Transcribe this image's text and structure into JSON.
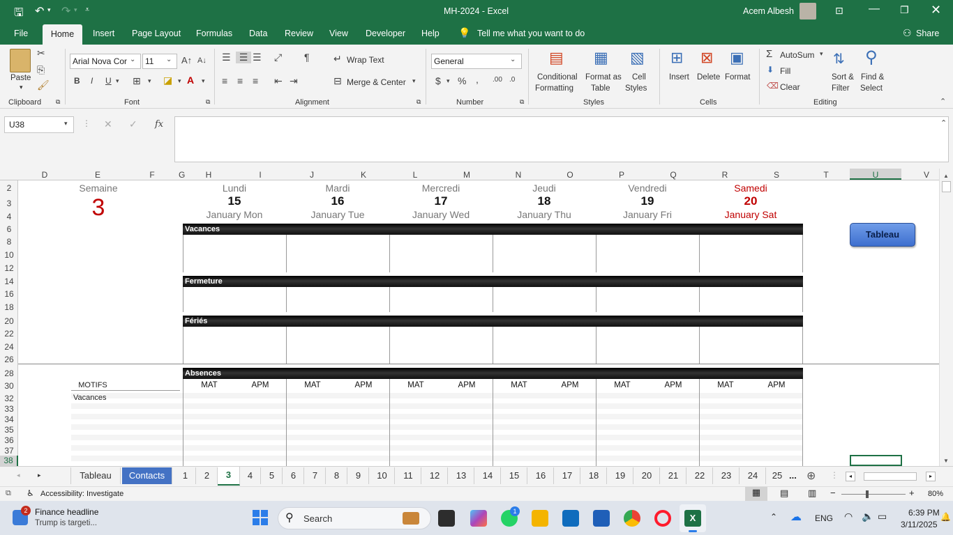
{
  "titlebar": {
    "title": "MH-2024  -  Excel",
    "user": "Acem Albesh"
  },
  "menu": {
    "file": "File",
    "home": "Home",
    "insert": "Insert",
    "page_layout": "Page Layout",
    "formulas": "Formulas",
    "data": "Data",
    "review": "Review",
    "view": "View",
    "developer": "Developer",
    "help": "Help",
    "tell_me": "Tell me what you want to do",
    "share": "Share"
  },
  "ribbon": {
    "paste": "Paste",
    "clipboard": "Clipboard",
    "font_name": "Arial Nova Cor",
    "font_size": "11",
    "font": "Font",
    "bold": "B",
    "italic": "I",
    "underline": "U",
    "wrap_text": "Wrap Text",
    "merge_center": "Merge & Center",
    "alignment": "Alignment",
    "number_format": "General",
    "number": "Number",
    "conditional_formatting_1": "Conditional",
    "conditional_formatting_2": "Formatting",
    "format_as_table_1": "Format as",
    "format_as_table_2": "Table",
    "cell_styles_1": "Cell",
    "cell_styles_2": "Styles",
    "styles": "Styles",
    "insert": "Insert",
    "delete": "Delete",
    "format": "Format",
    "cells": "Cells",
    "autosum": "AutoSum",
    "fill": "Fill",
    "clear": "Clear",
    "sort_filter_1": "Sort &",
    "sort_filter_2": "Filter",
    "find_select_1": "Find &",
    "find_select_2": "Select",
    "editing": "Editing"
  },
  "formula_bar": {
    "name_box": "U38",
    "fx": "fx",
    "value": ""
  },
  "columns": [
    "D",
    "E",
    "F",
    "G",
    "H",
    "I",
    "J",
    "K",
    "L",
    "M",
    "N",
    "O",
    "P",
    "Q",
    "R",
    "S",
    "T",
    "U",
    "V"
  ],
  "rows": [
    "2",
    "3",
    "4",
    "6",
    "8",
    "10",
    "12",
    "14",
    "16",
    "18",
    "20",
    "22",
    "24",
    "26",
    "28",
    "30",
    "32",
    "33",
    "34",
    "35",
    "36",
    "37",
    "38"
  ],
  "sheet": {
    "semaine_label": "Semaine",
    "semaine_num": "3",
    "days": [
      {
        "name": "Lundi",
        "num": "15",
        "sub": "January Mon"
      },
      {
        "name": "Mardi",
        "num": "16",
        "sub": "January Tue"
      },
      {
        "name": "Mercredi",
        "num": "17",
        "sub": "January Wed"
      },
      {
        "name": "Jeudi",
        "num": "18",
        "sub": "January Thu"
      },
      {
        "name": "Vendredi",
        "num": "19",
        "sub": "January Fri"
      },
      {
        "name": "Samedi",
        "num": "20",
        "sub": "January Sat"
      }
    ],
    "sections": {
      "vacances": "Vacances",
      "fermeture": "Fermeture",
      "feries": "Fériés",
      "absences": "Absences"
    },
    "mat": "MAT",
    "apm": "APM",
    "motifs": "MOTIFS",
    "motif_vacances": "Vacances",
    "tableau_button": "Tableau",
    "accent_red": "#c00000"
  },
  "tabs": {
    "tableau": "Tableau",
    "contacts": "Contacts",
    "numbers": [
      "1",
      "2",
      "3",
      "4",
      "5",
      "6",
      "7",
      "8",
      "9",
      "10",
      "11",
      "12",
      "13",
      "14",
      "15",
      "16",
      "17",
      "18",
      "19",
      "20",
      "21",
      "22",
      "23",
      "24",
      "25"
    ],
    "more": "...",
    "active": "3"
  },
  "status": {
    "accessibility": "Accessibility: Investigate",
    "zoom": "80%"
  },
  "taskbar": {
    "news_badge": "2",
    "news_title": "Finance headline",
    "news_sub": "Trump is targeti...",
    "search": "Search",
    "whatsapp_badge": "1",
    "lang": "ENG",
    "time": "6:39 PM",
    "date": "3/11/2025"
  }
}
